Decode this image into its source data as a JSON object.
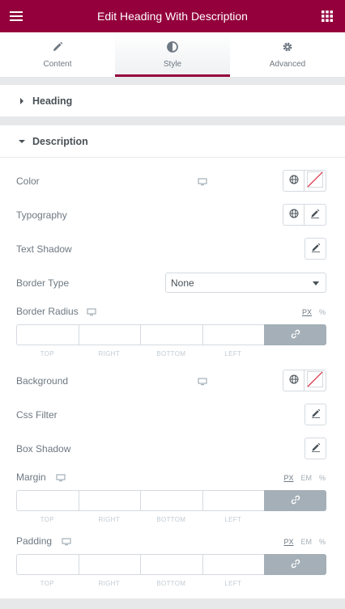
{
  "header": {
    "title": "Edit Heading With Description",
    "menu_icon": "hamburger-icon",
    "grid_icon": "apps-grid-icon",
    "bg_color": "#93003c"
  },
  "tabs": [
    {
      "label": "Content",
      "icon": "pencil-icon",
      "active": false
    },
    {
      "label": "Style",
      "icon": "half-circle-icon",
      "active": true
    },
    {
      "label": "Advanced",
      "icon": "gear-icon",
      "active": false
    }
  ],
  "sections": {
    "heading": {
      "title": "Heading",
      "expanded": false
    },
    "description": {
      "title": "Description",
      "expanded": true
    }
  },
  "controls": {
    "color": {
      "label": "Color"
    },
    "typography": {
      "label": "Typography"
    },
    "text_shadow": {
      "label": "Text Shadow"
    },
    "border_type": {
      "label": "Border Type",
      "value": "None"
    },
    "border_radius": {
      "label": "Border Radius",
      "units": [
        "PX",
        "%"
      ],
      "selected_unit": "PX"
    },
    "background": {
      "label": "Background"
    },
    "css_filter": {
      "label": "Css Filter"
    },
    "box_shadow": {
      "label": "Box Shadow"
    },
    "margin": {
      "label": "Margin",
      "units": [
        "PX",
        "EM",
        "%"
      ],
      "selected_unit": "PX"
    },
    "padding": {
      "label": "Padding",
      "units": [
        "PX",
        "EM",
        "%"
      ],
      "selected_unit": "PX"
    }
  },
  "dimension_labels": [
    "TOP",
    "RIGHT",
    "BOTTOM",
    "LEFT"
  ]
}
